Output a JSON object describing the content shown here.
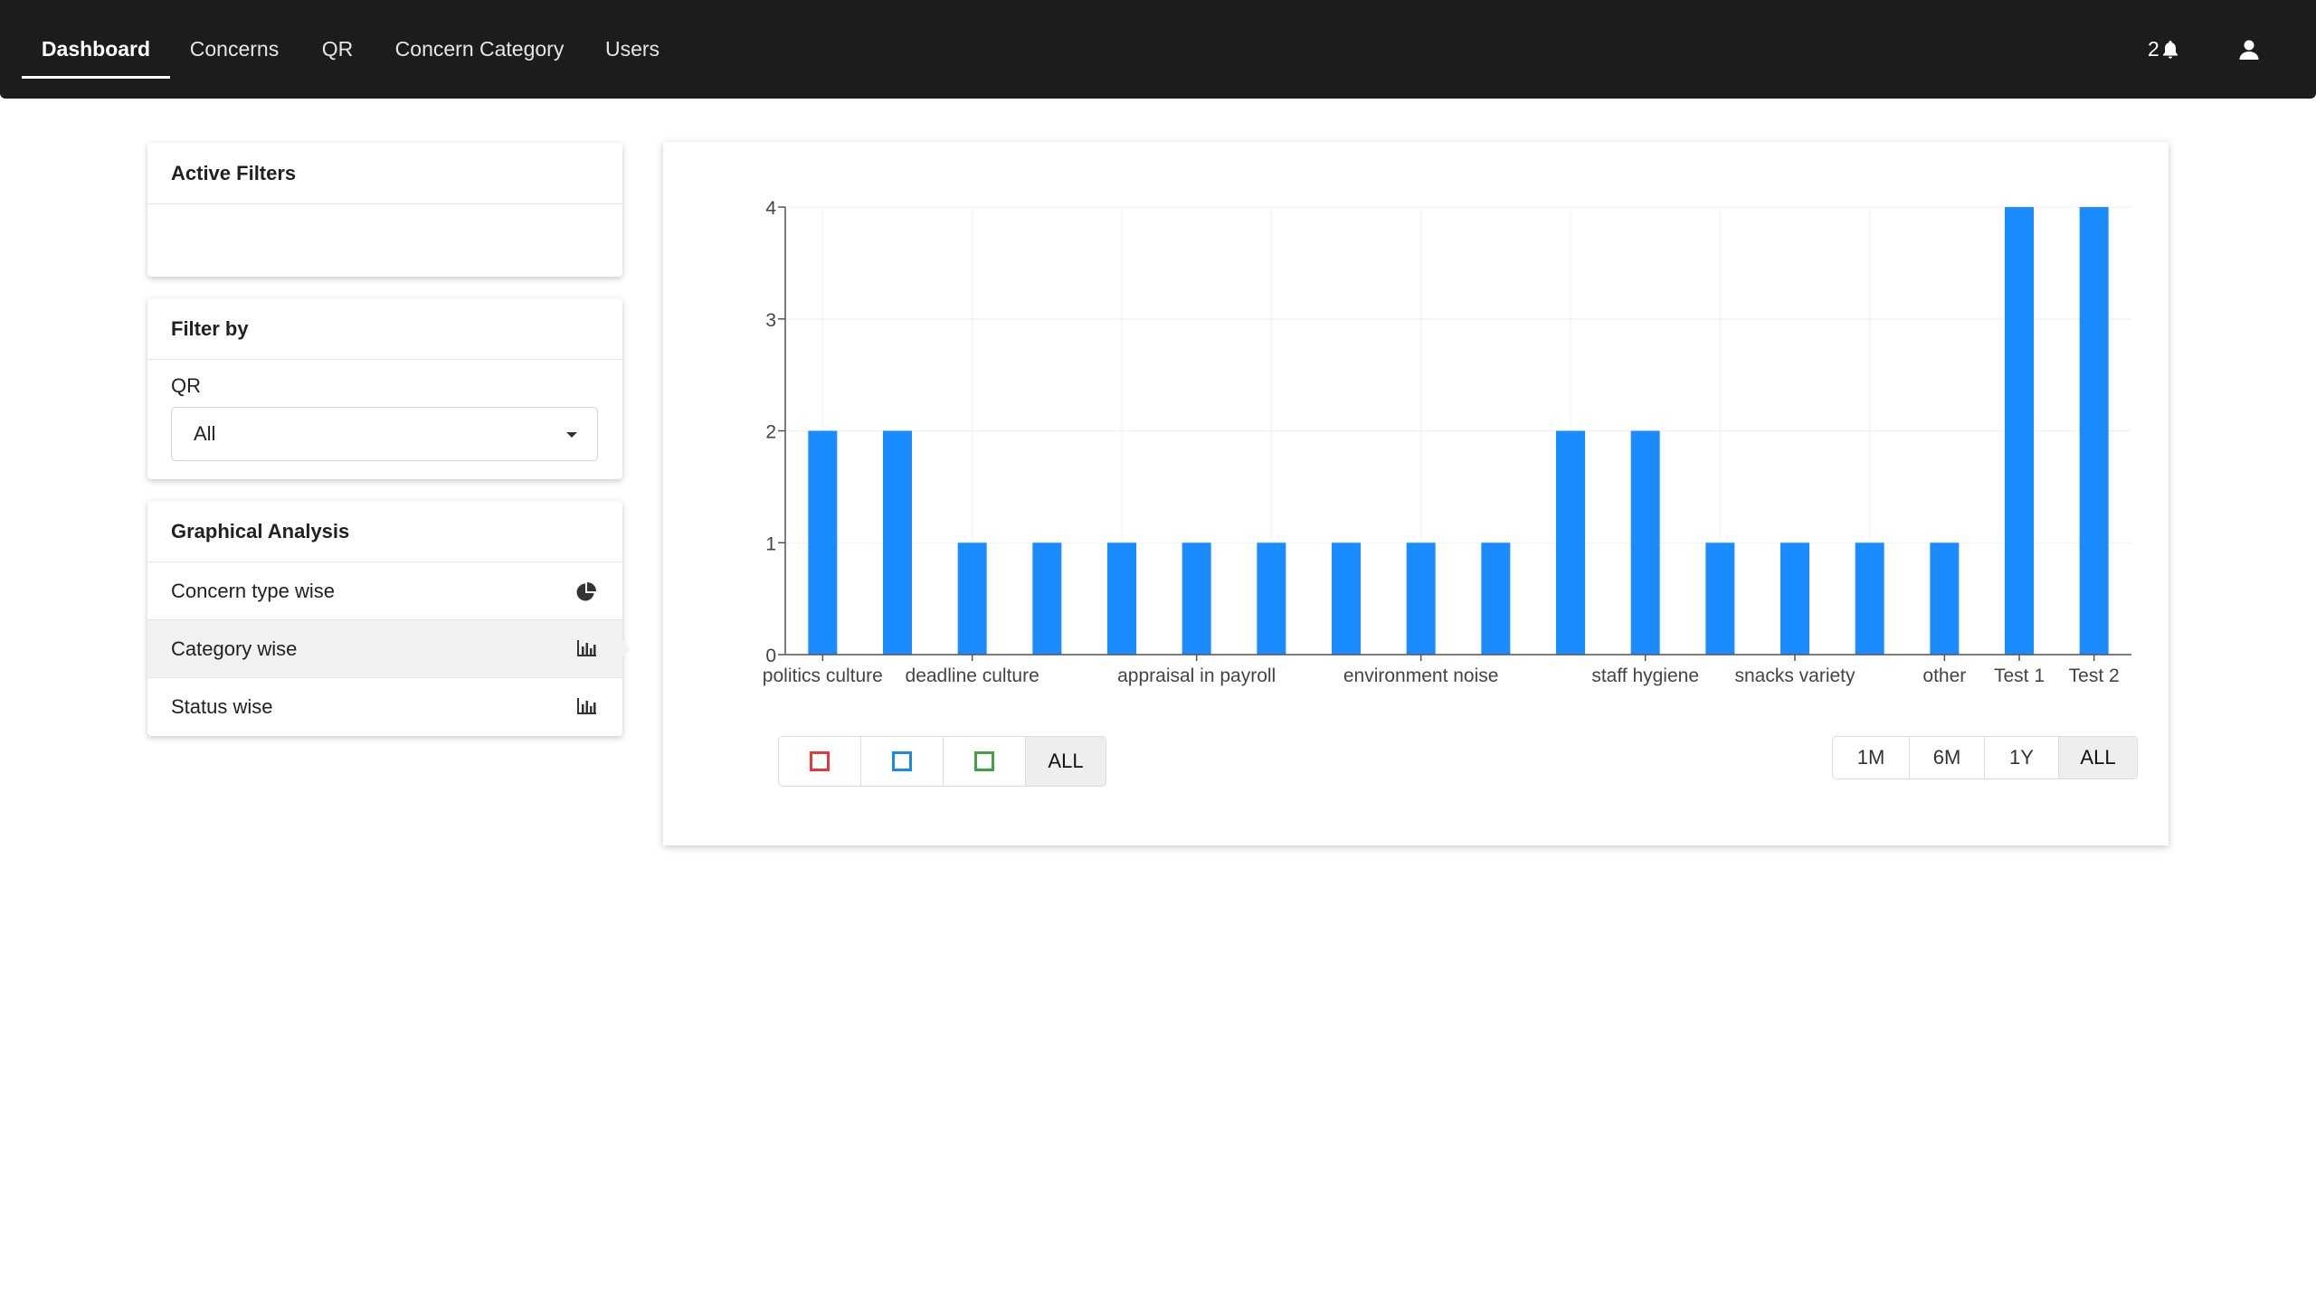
{
  "nav": {
    "tabs": [
      {
        "label": "Dashboard",
        "active": true
      },
      {
        "label": "Concerns"
      },
      {
        "label": "QR"
      },
      {
        "label": "Concern Category"
      },
      {
        "label": "Users"
      }
    ],
    "notification_count": "2",
    "bell_icon": "bell-icon",
    "user_icon": "user-icon"
  },
  "active_filters": {
    "title": "Active Filters"
  },
  "filter_by": {
    "title": "Filter by",
    "qr_label": "QR",
    "qr_value": "All"
  },
  "graphical_analysis": {
    "title": "Graphical Analysis",
    "items": [
      {
        "label": "Concern type wise",
        "icon": "pie-chart-icon"
      },
      {
        "label": "Category wise",
        "icon": "bar-chart-icon",
        "active": true
      },
      {
        "label": "Status wise",
        "icon": "bar-chart-icon"
      }
    ]
  },
  "status_filters": {
    "items": [
      {
        "color": "#e53935"
      },
      {
        "color": "#1e88e5"
      },
      {
        "color": "#43a047"
      }
    ],
    "all_label": "ALL"
  },
  "time_filters": [
    {
      "label": "1M"
    },
    {
      "label": "6M"
    },
    {
      "label": "1Y"
    },
    {
      "label": "ALL",
      "active": true
    }
  ],
  "chart_data": {
    "type": "bar",
    "bar_color": "#1a8cff",
    "ylim": [
      0,
      4
    ],
    "yticks": [
      0,
      1,
      2,
      3,
      4
    ],
    "values": [
      2,
      2,
      1,
      1,
      1,
      1,
      1,
      1,
      1,
      1,
      2,
      2,
      1,
      1,
      1,
      1,
      4,
      4
    ],
    "tick_labels": [
      {
        "index": 0,
        "label": "politics culture"
      },
      {
        "index": 2,
        "label": "deadline culture"
      },
      {
        "index": 5,
        "label": "appraisal in payroll"
      },
      {
        "index": 8,
        "label": "environment noise"
      },
      {
        "index": 11,
        "label": "staff hygiene"
      },
      {
        "index": 13,
        "label": "snacks variety"
      },
      {
        "index": 15,
        "label": "other"
      },
      {
        "index": 16,
        "label": "Test 1"
      },
      {
        "index": 17,
        "label": "Test 2"
      }
    ],
    "grid": true
  }
}
